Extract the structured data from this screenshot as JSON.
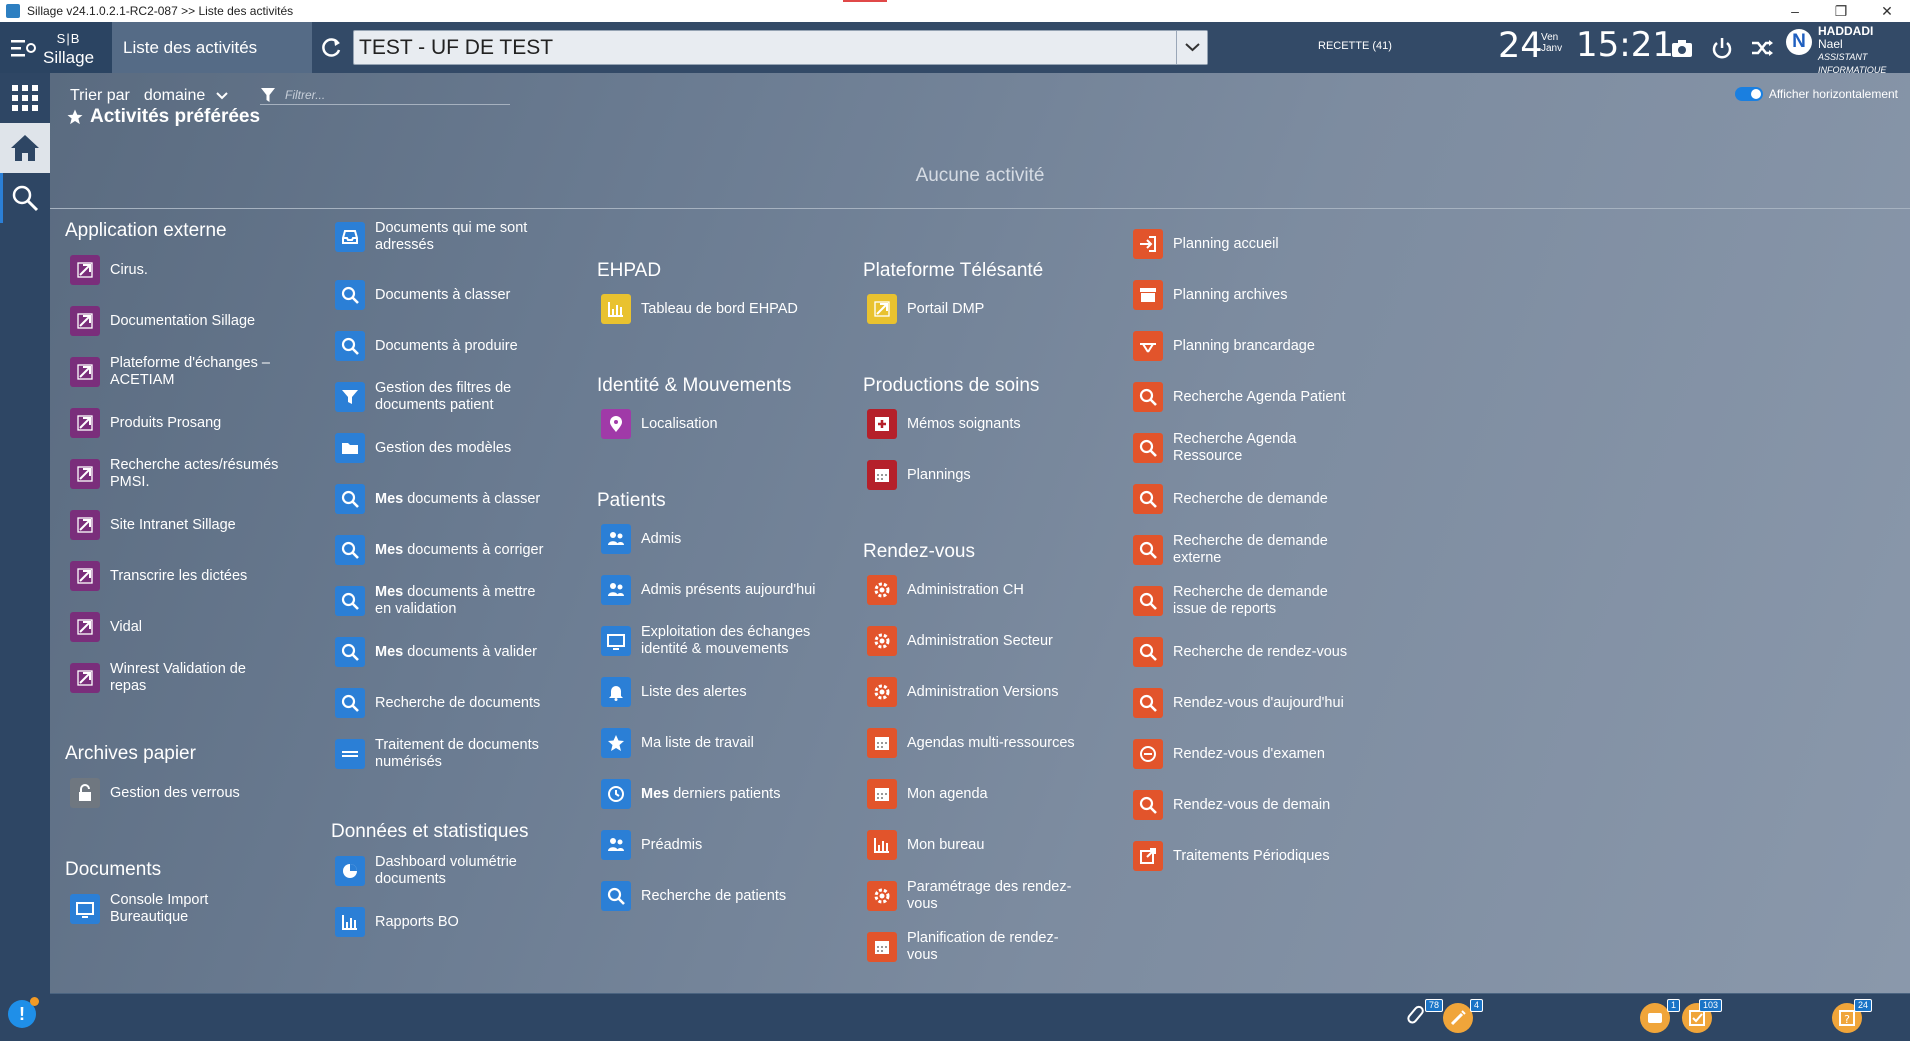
{
  "window": {
    "title": "Sillage v24.1.0.2.1-RC2-087 >> Liste des activités"
  },
  "brand": {
    "line1": "S|B",
    "line2": "Sillage"
  },
  "current_tab": "Liste des activités",
  "uf_select": {
    "value": "TEST - UF DE TEST"
  },
  "environment": "RECETTE (41)",
  "date": {
    "day": "24",
    "weekday": "Ven",
    "month": "Janv"
  },
  "clock": "15:21",
  "user": {
    "initial": "N",
    "last_name": "HADDADI",
    "first_name": "Nael",
    "role": "ASSISTANT INFORMATIQUE"
  },
  "toolbar": {
    "sort_label": "Trier par",
    "sort_value": "domaine",
    "filter_placeholder": "Filtrer...",
    "horizontal_label": "Afficher horizontalement"
  },
  "favorites": {
    "title": "Activités préférées",
    "empty": "Aucune activité"
  },
  "sections": {
    "app_externe": {
      "title": "Application externe",
      "items": [
        "Cirus.",
        "Documentation Sillage",
        "Plateforme d'échanges – ACETIAM",
        "Produits Prosang",
        "Recherche actes/résumés PMSI.",
        "Site Intranet Sillage",
        "Transcrire les dictées",
        "Vidal",
        "Winrest Validation de repas"
      ]
    },
    "archives": {
      "title": "Archives papier",
      "items": [
        "Gestion des verrous"
      ]
    },
    "documents": {
      "title": "Documents",
      "items": [
        "Console Import Bureautique",
        "Documents qui me sont adressés",
        "Documents à classer",
        "Documents à produire",
        "Gestion des filtres de documents patient",
        "Gestion des modèles",
        "Mes documents à classer",
        "Mes documents à corriger",
        "Mes documents à mettre en validation",
        "Mes documents à valider",
        "Recherche de documents",
        "Traitement de documents numérisés"
      ]
    },
    "donnees": {
      "title": "Données et statistiques",
      "items": [
        "Dashboard volumétrie documents",
        "Rapports BO"
      ]
    },
    "ehpad": {
      "title": "EHPAD",
      "items": [
        "Tableau de bord EHPAD"
      ]
    },
    "identite": {
      "title": "Identité & Mouvements",
      "items": [
        "Localisation"
      ]
    },
    "patients": {
      "title": "Patients",
      "items": [
        "Admis",
        "Admis présents aujourd'hui",
        "Exploitation des échanges identité & mouvements",
        "Liste des alertes",
        "Ma liste de travail",
        "Mes derniers patients",
        "Préadmis",
        "Recherche de patients"
      ]
    },
    "telesante": {
      "title": "Plateforme Télésanté",
      "items": [
        "Portail DMP"
      ]
    },
    "soins": {
      "title": "Productions de soins",
      "items": [
        "Mémos soignants",
        "Plannings"
      ]
    },
    "rdv": {
      "title": "Rendez-vous",
      "items": [
        "Administration CH",
        "Administration Secteur",
        "Administration Versions",
        "Agendas multi-ressources",
        "Mon agenda",
        "Mon bureau",
        "Paramétrage des rendez-vous",
        "Planification de rendez-vous",
        "Planning accueil",
        "Planning archives",
        "Planning brancardage",
        "Recherche Agenda Patient",
        "Recherche Agenda Ressource",
        "Recherche de demande",
        "Recherche de demande externe",
        "Recherche de demande issue de reports",
        "Recherche de rendez-vous",
        "Rendez-vous d'aujourd'hui",
        "Rendez-vous d'examen",
        "Rendez-vous de demain",
        "Traitements Périodiques"
      ]
    }
  },
  "bold_prefix": "Mes",
  "bottom": {
    "badges": [
      "78",
      "4",
      "1",
      "103",
      "24"
    ]
  }
}
